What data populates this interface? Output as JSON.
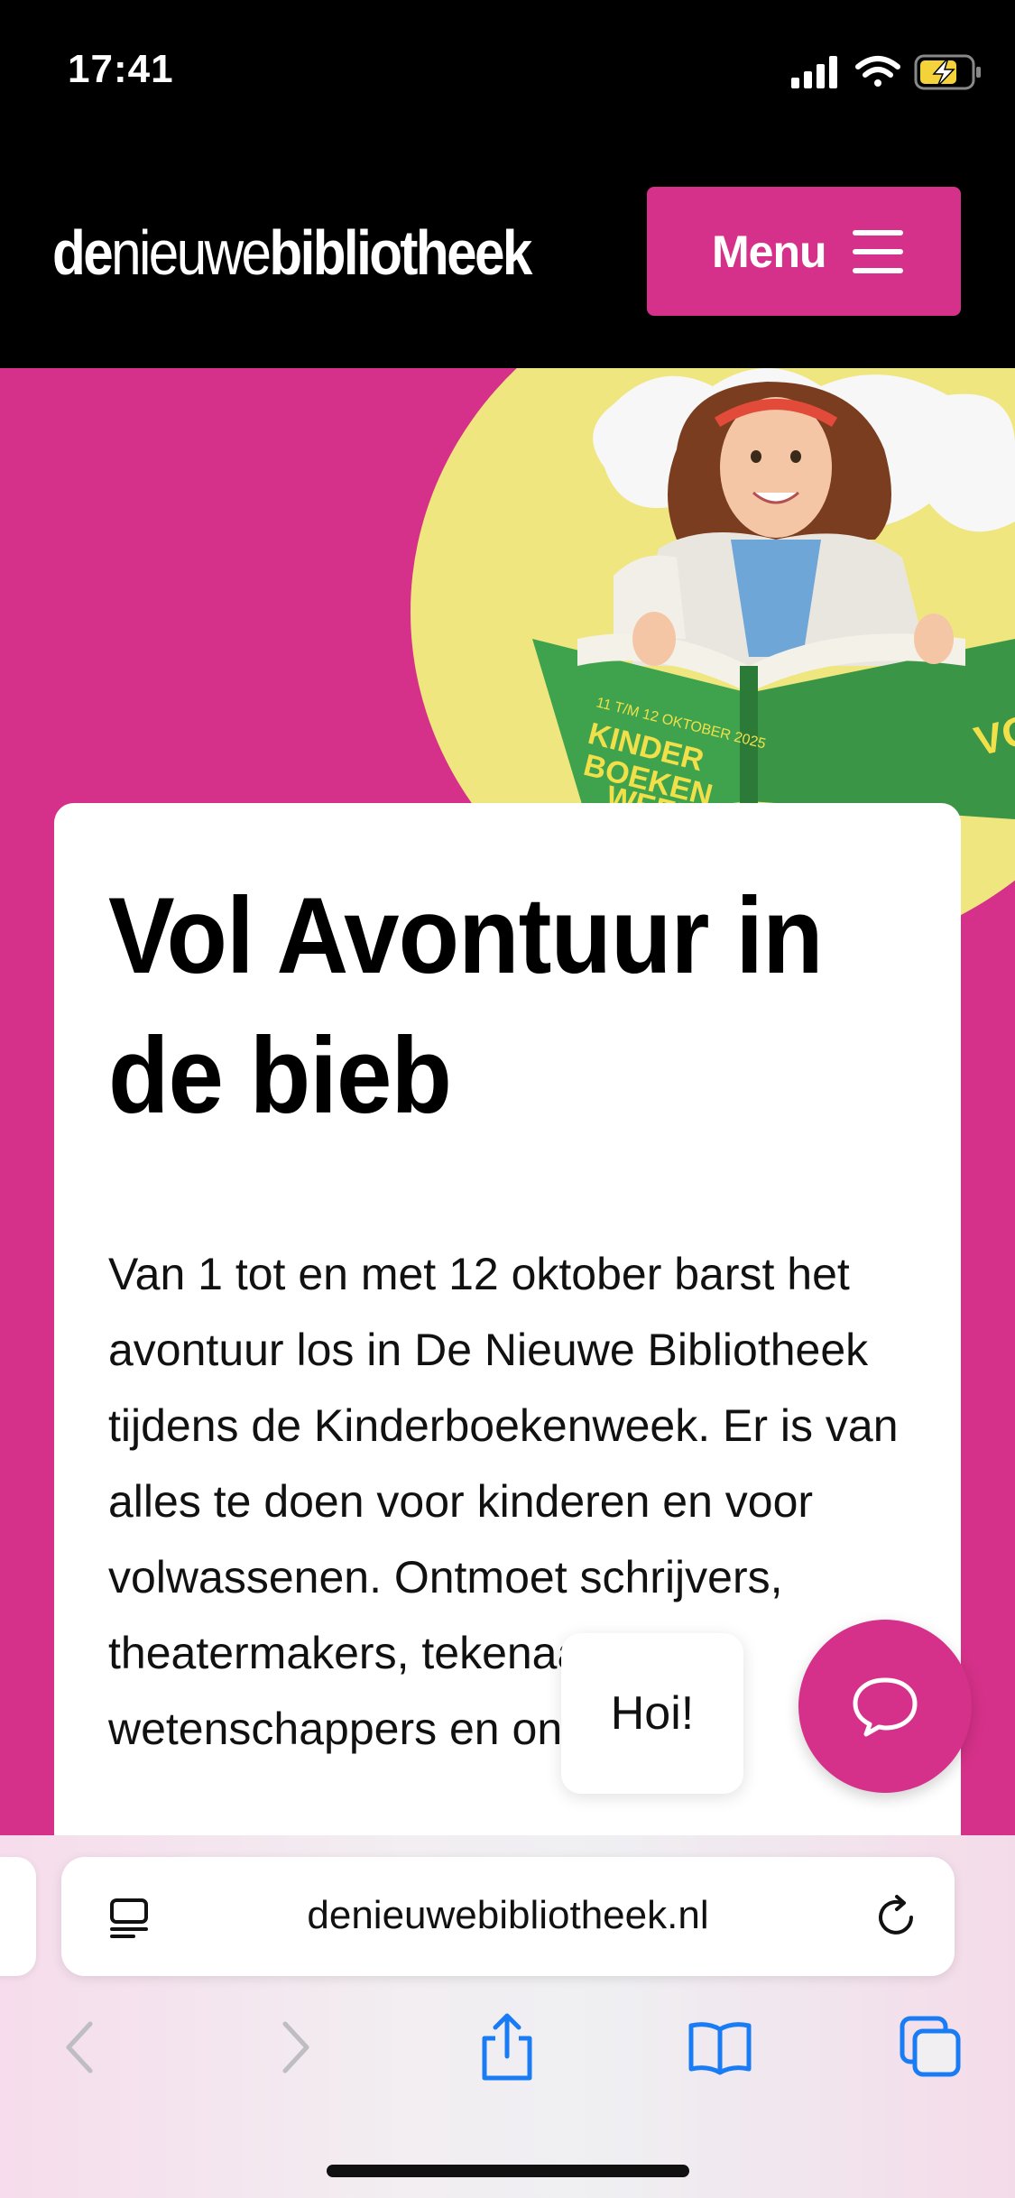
{
  "status_bar": {
    "time": "17:41",
    "icons": [
      "cellular-icon",
      "wifi-icon",
      "battery-charging-icon"
    ]
  },
  "header": {
    "logo": {
      "part1": "de",
      "part2": "nieuwe",
      "part3": "bibliotheek"
    },
    "menu_label": "Menu"
  },
  "hero": {
    "illustration": "kinderboekenweek-girl-on-book-image",
    "book_text": "11 T/M 12 OKTOBER 2025 KINDER BOEKEN WEEK"
  },
  "article": {
    "title": "Vol Avontuur in de bieb",
    "body": "Van 1 tot en met 12 oktober barst het avontuur los in De Nieuwe Bibliotheek tijdens de Kinderboekenweek. Er is van alles te doen voor kinderen en voor volwassenen. Ontmoet schrijvers, theatermakers, tekenaars, wetenschappers en ontdek nog"
  },
  "chat": {
    "greeting": "Hoi!",
    "button_icon": "chat-icon"
  },
  "browser": {
    "url": "denieuwebibliotheek.nl",
    "toolbar": [
      "back-icon",
      "forward-icon",
      "share-icon",
      "bookmarks-icon",
      "tabs-icon"
    ]
  },
  "colors": {
    "brand_pink": "#d6318a",
    "header_black": "#000000",
    "accent_yellow": "#efe67f",
    "ios_blue": "#1a7cf5"
  }
}
